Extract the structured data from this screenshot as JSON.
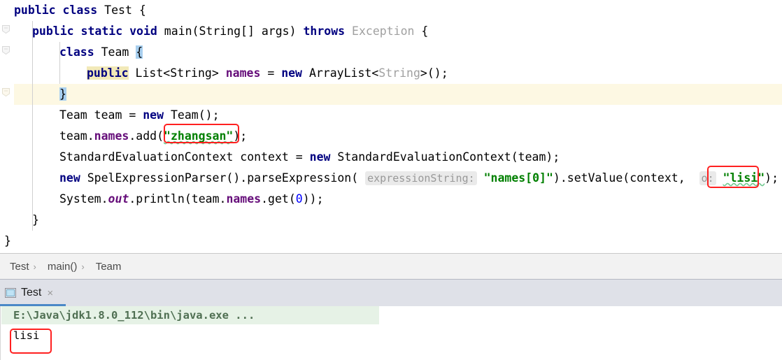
{
  "editor": {
    "lines": [
      {
        "id": "line-1",
        "indent": 0,
        "text": "public class Test {"
      },
      {
        "id": "line-2",
        "indent": 1,
        "text": "public static void main(String[] args) throws Exception {"
      },
      {
        "id": "line-3",
        "indent": 2,
        "text": "class Team {"
      },
      {
        "id": "line-4",
        "indent": 3,
        "text": "public List<String> names = new ArrayList<String>();"
      },
      {
        "id": "line-5",
        "indent": 2,
        "text": "}"
      },
      {
        "id": "line-6",
        "indent": 2,
        "text": "Team team = new Team();"
      },
      {
        "id": "line-7",
        "indent": 2,
        "text": "team.names.add(\"zhangsan\");"
      },
      {
        "id": "line-8",
        "indent": 2,
        "text": "StandardEvaluationContext context = new StandardEvaluationContext(team);"
      },
      {
        "id": "line-9",
        "indent": 2,
        "text": "new SpelExpressionParser().parseExpression( expressionString: \"names[0]\").setValue(context,  o: \"lisi\");"
      },
      {
        "id": "line-10",
        "indent": 2,
        "text": "System.out.println(team.names.get(0));"
      },
      {
        "id": "line-11",
        "indent": 1,
        "text": "}"
      },
      {
        "id": "line-12",
        "indent": 0,
        "text": "}"
      }
    ],
    "tokens": {
      "l1": {
        "kw_public": "public",
        "kw_class": "class",
        "name": "Test",
        "brace": "{"
      },
      "l2": {
        "kw_public": "public",
        "kw_static": "static",
        "kw_void": "void",
        "method": "main(",
        "type_string": "String[]",
        "arg": "args)",
        "kw_throws": "throws",
        "exception": "Exception",
        "brace": "{"
      },
      "l3": {
        "kw_class": "class",
        "name": "Team",
        "brace": "{"
      },
      "l4": {
        "kw_public": "public",
        "type": "List<String>",
        "field": "names",
        "eq": "=",
        "kw_new": "new",
        "ctor": "ArrayList<",
        "generic": "String",
        "ctor_end": ">();"
      },
      "l5": {
        "brace": "}"
      },
      "l6": {
        "type": "Team team ",
        "eq": "= ",
        "kw_new": "new",
        "ctor": " Team();"
      },
      "l7": {
        "pre": "team.",
        "field": "names",
        "mid": ".add(",
        "str": "\"zhangsan\"",
        "post": ");"
      },
      "l8": {
        "type": "StandardEvaluationContext context ",
        "eq": "= ",
        "kw_new": "new",
        "ctor": " StandardEvaluationContext(team);"
      },
      "l9": {
        "kw_new": "new",
        "call": " SpelExpressionParser().parseExpression(",
        "hint1": "expressionString:",
        "str1": "\"names[0]\"",
        "mid": ").setValue(context, ",
        "hint2": "o:",
        "str2": "\"lisi\"",
        "post": ");"
      },
      "l10": {
        "sys": "System.",
        "statfld": "out",
        "mid": ".println(team.",
        "field": "names",
        "get": ".get(",
        "num": "0",
        "post": "));"
      },
      "l11": {
        "brace": "}"
      },
      "l12": {
        "brace": "}"
      }
    },
    "gutter": {
      "fold_icon_name": "code-fold-marker"
    }
  },
  "breadcrumb": {
    "items": [
      "Test",
      "main()",
      "Team"
    ],
    "separator": "›"
  },
  "run_window": {
    "tab": {
      "label": "Test",
      "close": "×",
      "icon": "console-icon"
    },
    "console": {
      "command_line": "E:\\Java\\jdk1.8.0_112\\bin\\java.exe ...",
      "output_line": "lisi"
    }
  },
  "annotations": {
    "boxes": [
      {
        "name": "redbox-zhangsan",
        "label": "\"zhangsan\""
      },
      {
        "name": "redbox-lisi-code",
        "label": "\"lisi\""
      },
      {
        "name": "redbox-lisi-console",
        "label": "lisi"
      }
    ],
    "color": "#ff2020"
  },
  "colors": {
    "keyword": "#000080",
    "string": "#008000",
    "field": "#660e7a",
    "grey_type": "#a0a0a0",
    "current_line_bg": "#fdf8e3",
    "brace_match_bg": "#a8cfef",
    "identifier_highlight_bg": "#f2e9b8",
    "console_cmd_bg": "#e6f2e6",
    "tab_underline": "#4a88c7",
    "annotation_red": "#ff2020"
  }
}
